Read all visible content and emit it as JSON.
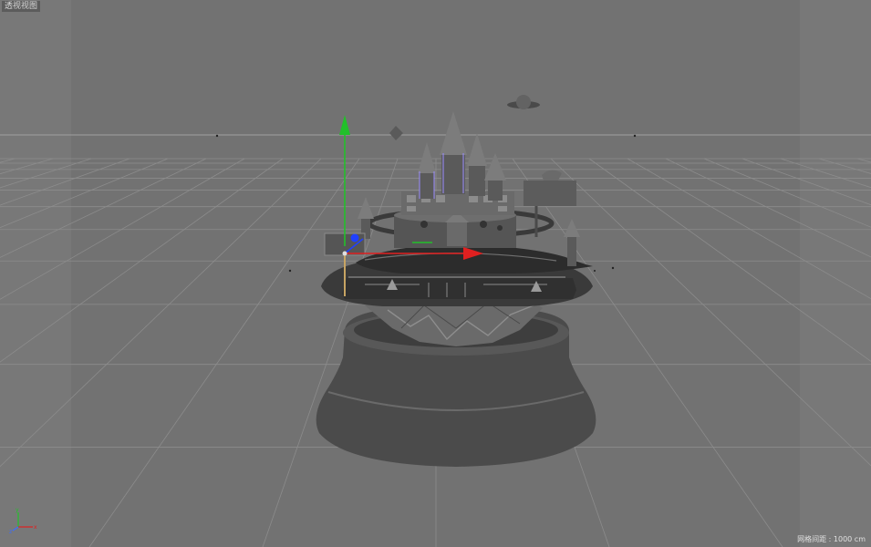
{
  "viewport": {
    "label": "透视视图",
    "grid_spacing": "网格间距 : 1000 cm"
  },
  "colors": {
    "background": "#727272",
    "grid_line": "#8a8a8a",
    "horizon": "#a8a8a8",
    "axis_x": "#e02020",
    "axis_y": "#22c02a",
    "axis_z": "#2040ff",
    "model": "#4a4a4a",
    "model_light": "#8c8c8c",
    "model_dark": "#2a2a2a"
  },
  "scene": {
    "object": "castle-music-box-model",
    "gizmo": "move-axis-gizmo",
    "orientation_icon": "world-axis-icon"
  }
}
